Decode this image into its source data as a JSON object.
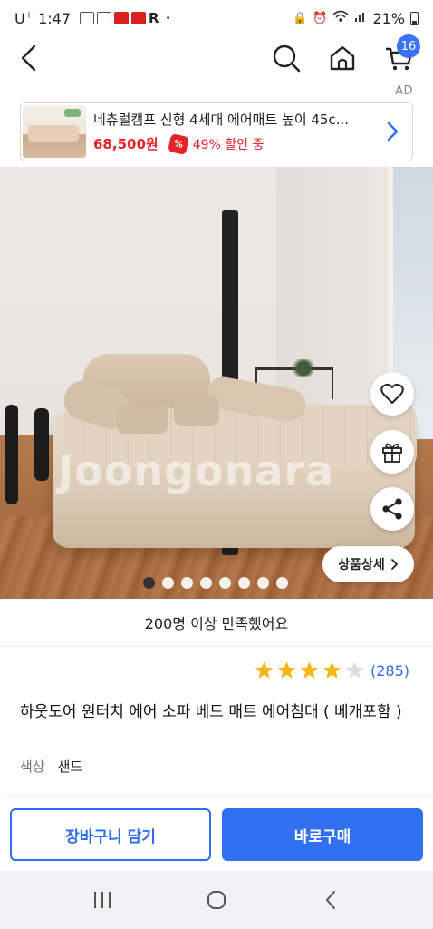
{
  "status_bar": {
    "carrier": "U",
    "carrier_sup": "+",
    "time": "1:47",
    "notif_r": "R",
    "dot": "•",
    "battery_pct": "21%"
  },
  "cart": {
    "badge_count": "16"
  },
  "ad": {
    "label": "AD",
    "title": "네츄럴캠프 신형 4세대 에어매트 높이 45c...",
    "price": "68,500원",
    "discount": "49% 할인 중",
    "pct_icon": "%"
  },
  "hero": {
    "watermark": "Joongonara",
    "detail_button": "상품상세",
    "image_count": 8,
    "active_index": 0
  },
  "satisfaction": "200명 이상 만족했어요",
  "rating": {
    "stars": 4,
    "max": 5,
    "count": "(285)"
  },
  "product": {
    "title": "하웃도어 원터치 에어 소파 베드 매트 에어침대 ( 베개포함 )",
    "option_key": "색상",
    "option_value": "샌드"
  },
  "actions": {
    "cart_label": "장바구니 담기",
    "buy_label": "바로구매"
  },
  "colors": {
    "accent": "#3270f2",
    "price_red": "#e5222a",
    "star": "#f5b81c"
  }
}
